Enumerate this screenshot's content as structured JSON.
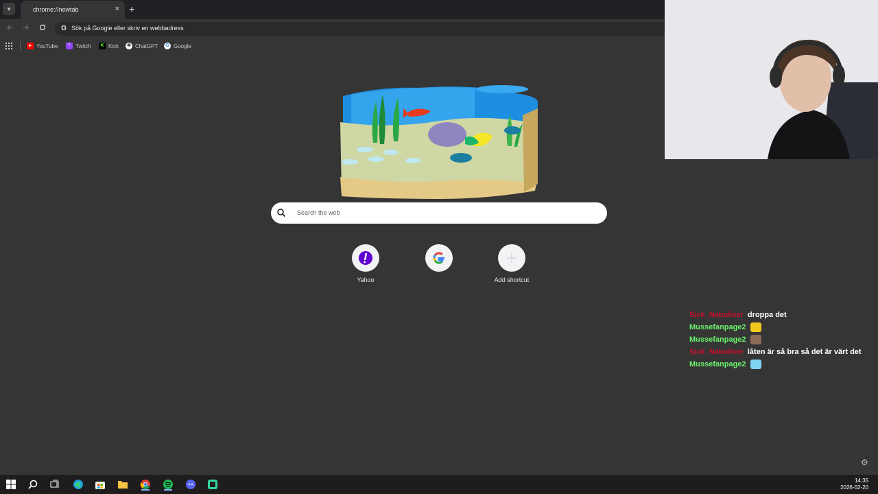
{
  "browser": {
    "tab_title": "chrome://newtab",
    "tab_close": "×",
    "new_tab": "+",
    "omnibox_text": "Sök på Google eller skriv en webbadress",
    "omnibox_icon": "G"
  },
  "bookmarks": [
    {
      "label": "YouTube",
      "icon": "youtube-icon",
      "color": "#ff0000"
    },
    {
      "label": "Twitch",
      "icon": "twitch-icon",
      "color": "#9146ff"
    },
    {
      "label": "Kick",
      "icon": "kick-icon",
      "color": "#53fc18"
    },
    {
      "label": "ChatGPT",
      "icon": "chatgpt-icon",
      "color": "#ffffff"
    },
    {
      "label": "Google",
      "icon": "google-icon",
      "color": "#4285f4"
    }
  ],
  "search": {
    "placeholder": "Search the web"
  },
  "shortcuts": [
    {
      "label": "Yahoo",
      "icon": "yahoo-icon"
    },
    {
      "label": "",
      "icon": "google-icon"
    },
    {
      "label": "Add shortcut",
      "icon": "plus-icon"
    }
  ],
  "chat": [
    {
      "user": "Sick_Nebuliser",
      "message": "droppa det",
      "color": "#c8102e",
      "emote": ""
    },
    {
      "user": "Mussefanpage2",
      "message": "",
      "color": "#6cf26c",
      "emote": "yellow-face-emote"
    },
    {
      "user": "Mussefanpage2",
      "message": "",
      "color": "#6cf26c",
      "emote": "person-emote"
    },
    {
      "user": "Sick_Nebuliser",
      "message": "låten är så bra så det är värt det",
      "color": "#c8102e",
      "emote": ""
    },
    {
      "user": "Mussefanpage2",
      "message": "",
      "color": "#6cf26c",
      "emote": "cyan-emote"
    }
  ],
  "taskbar": {
    "time": "14:35",
    "date": "2026-02-20"
  },
  "colors": {
    "page_bg": "#353535",
    "tabstrip_bg": "#202124",
    "chat_green": "#6cf26c",
    "chat_red": "#c8102e"
  }
}
